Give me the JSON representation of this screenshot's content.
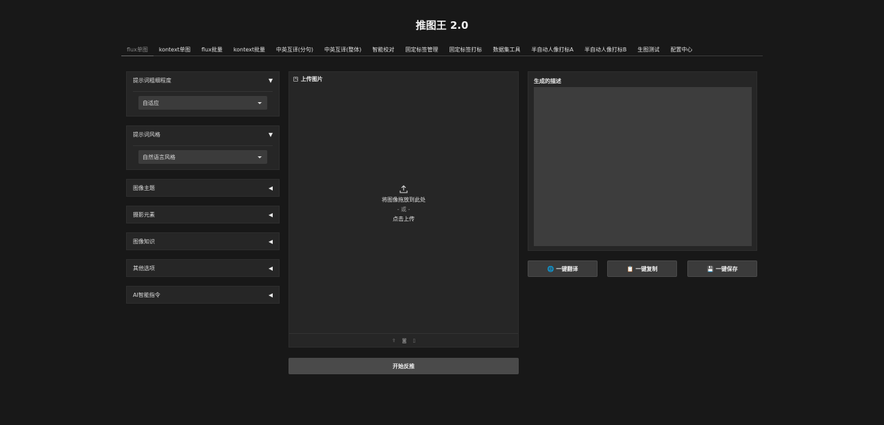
{
  "app": {
    "title": "推图王 2.0"
  },
  "tabs": [
    {
      "label": "flux单图",
      "active": true
    },
    {
      "label": "kontext单图"
    },
    {
      "label": "flux批量"
    },
    {
      "label": "kontext批量"
    },
    {
      "label": "中英互译(分句)"
    },
    {
      "label": "中英互译(整体)"
    },
    {
      "label": "智能校对"
    },
    {
      "label": "固定标签管理"
    },
    {
      "label": "固定标签打标"
    },
    {
      "label": "数据集工具"
    },
    {
      "label": "半自动人像打标A"
    },
    {
      "label": "半自动人像打标B"
    },
    {
      "label": "生图测试"
    },
    {
      "label": "配置中心"
    }
  ],
  "left": {
    "detail": {
      "label": "提示词粗细程度",
      "arrow": "▼",
      "value": "自适应"
    },
    "style": {
      "label": "提示词风格",
      "arrow": "▼",
      "value": "自然语言风格"
    },
    "collapsed": [
      {
        "label": "图像主题",
        "arrow": "◀"
      },
      {
        "label": "摄影元素",
        "arrow": "◀"
      },
      {
        "label": "图像知识",
        "arrow": "◀"
      },
      {
        "label": "其他选项",
        "arrow": "◀"
      },
      {
        "label": "AI智能指令",
        "arrow": "◀"
      }
    ]
  },
  "upload": {
    "label": "上传图片",
    "drop_text": "将图像拖放到此处",
    "or_text": "- 或 -",
    "click_text": "点击上传",
    "toolbar": [
      "upload-icon",
      "camera-icon",
      "clipboard-icon"
    ]
  },
  "start_button": "开始反推",
  "output": {
    "label": "生成的描述",
    "value": ""
  },
  "actions": {
    "translate": {
      "icon": "🌐",
      "label": "一键翻译"
    },
    "copy": {
      "icon": "📋",
      "label": "一键复制"
    },
    "save": {
      "icon": "💾",
      "label": "一键保存"
    }
  }
}
